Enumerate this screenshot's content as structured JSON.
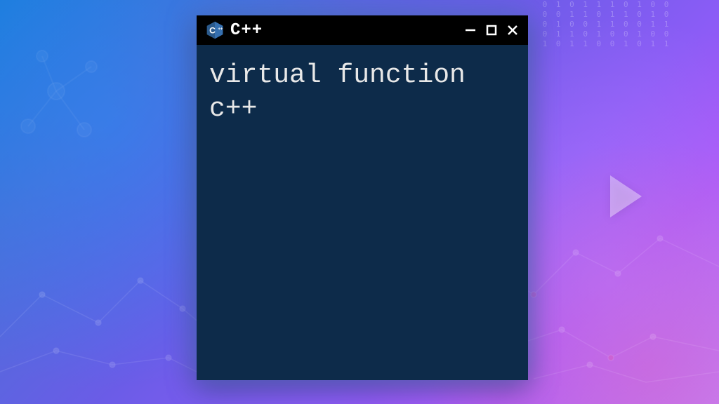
{
  "titlebar": {
    "title": "C++",
    "logo_letter": "C",
    "logo_plus": "++"
  },
  "terminal": {
    "content": "virtual function c++"
  },
  "window_controls": {
    "minimize": "minimize",
    "maximize": "maximize",
    "close": "close"
  },
  "background": {
    "binary_sample": "0 1 0 1 1\n1 0 1 0 0\n0 0 1 1 0\n1 1 0 1 0\n0 1 0 0 1\n1 0 0 1 1\n0 1 1 0 1\n0 0 1 0 0\n1 0 1 1 0\n0 1 0 1 1"
  }
}
